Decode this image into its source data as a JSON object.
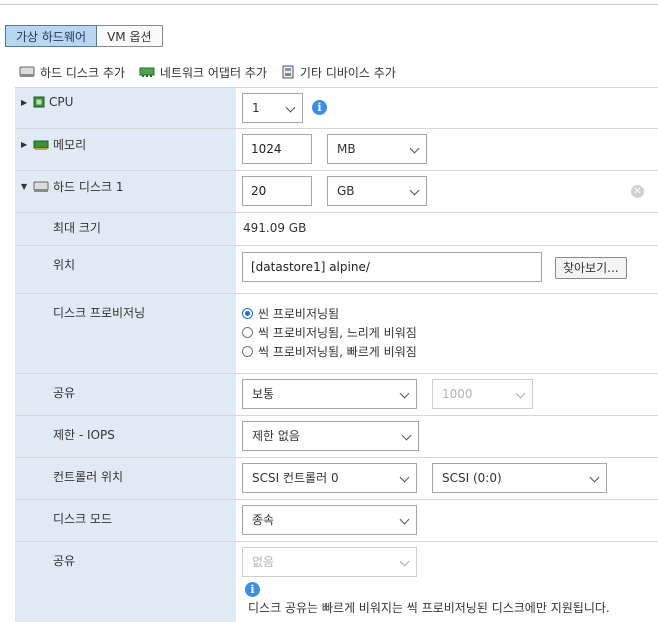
{
  "tabs": [
    {
      "label": "가상 하드웨어",
      "active": true
    },
    {
      "label": "VM 옵션",
      "active": false
    }
  ],
  "toolbar": {
    "add_disk": "하드 디스크 추가",
    "add_nic": "네트워크 어댑터 추가",
    "add_device": "기타 디바이스 추가"
  },
  "cpu": {
    "label": "CPU",
    "value": "1"
  },
  "memory": {
    "label": "메모리",
    "value": "1024",
    "unit": "MB"
  },
  "hdd": {
    "label": "하드 디스크 1",
    "size": "20",
    "unit": "GB",
    "max_label": "최대 크기",
    "max_value": "491.09 GB",
    "location_label": "위치",
    "location_value": "[datastore1] alpine/",
    "browse": "찾아보기...",
    "provision_label": "디스크 프로비저닝",
    "provision_options": [
      {
        "label": "씬 프로비저닝됨",
        "selected": true
      },
      {
        "label": "씩 프로비저닝됨, 느리게 비워짐",
        "selected": false
      },
      {
        "label": "씩 프로비저닝됨, 빠르게 비워짐",
        "selected": false
      }
    ],
    "shares_label": "공유",
    "shares_value": "보통",
    "shares_number": "1000",
    "iops_label": "제한 - IOPS",
    "iops_value": "제한 없음",
    "controller_label": "컨트롤러 위치",
    "controller_value": "SCSI 컨트롤러 0",
    "controller_slot": "SCSI (0:0)",
    "mode_label": "디스크 모드",
    "mode_value": "종속",
    "sharing_label": "공유",
    "sharing_value": "없음",
    "sharing_note": "디스크 공유는 빠르게 비워지는 씩 프로비저닝된 디스크에만 지원됩니다."
  },
  "colors": {
    "tab_active_bg": "#b9d5f0",
    "label_col_bg": "#dfeaf5",
    "accent": "#1a73d9"
  }
}
